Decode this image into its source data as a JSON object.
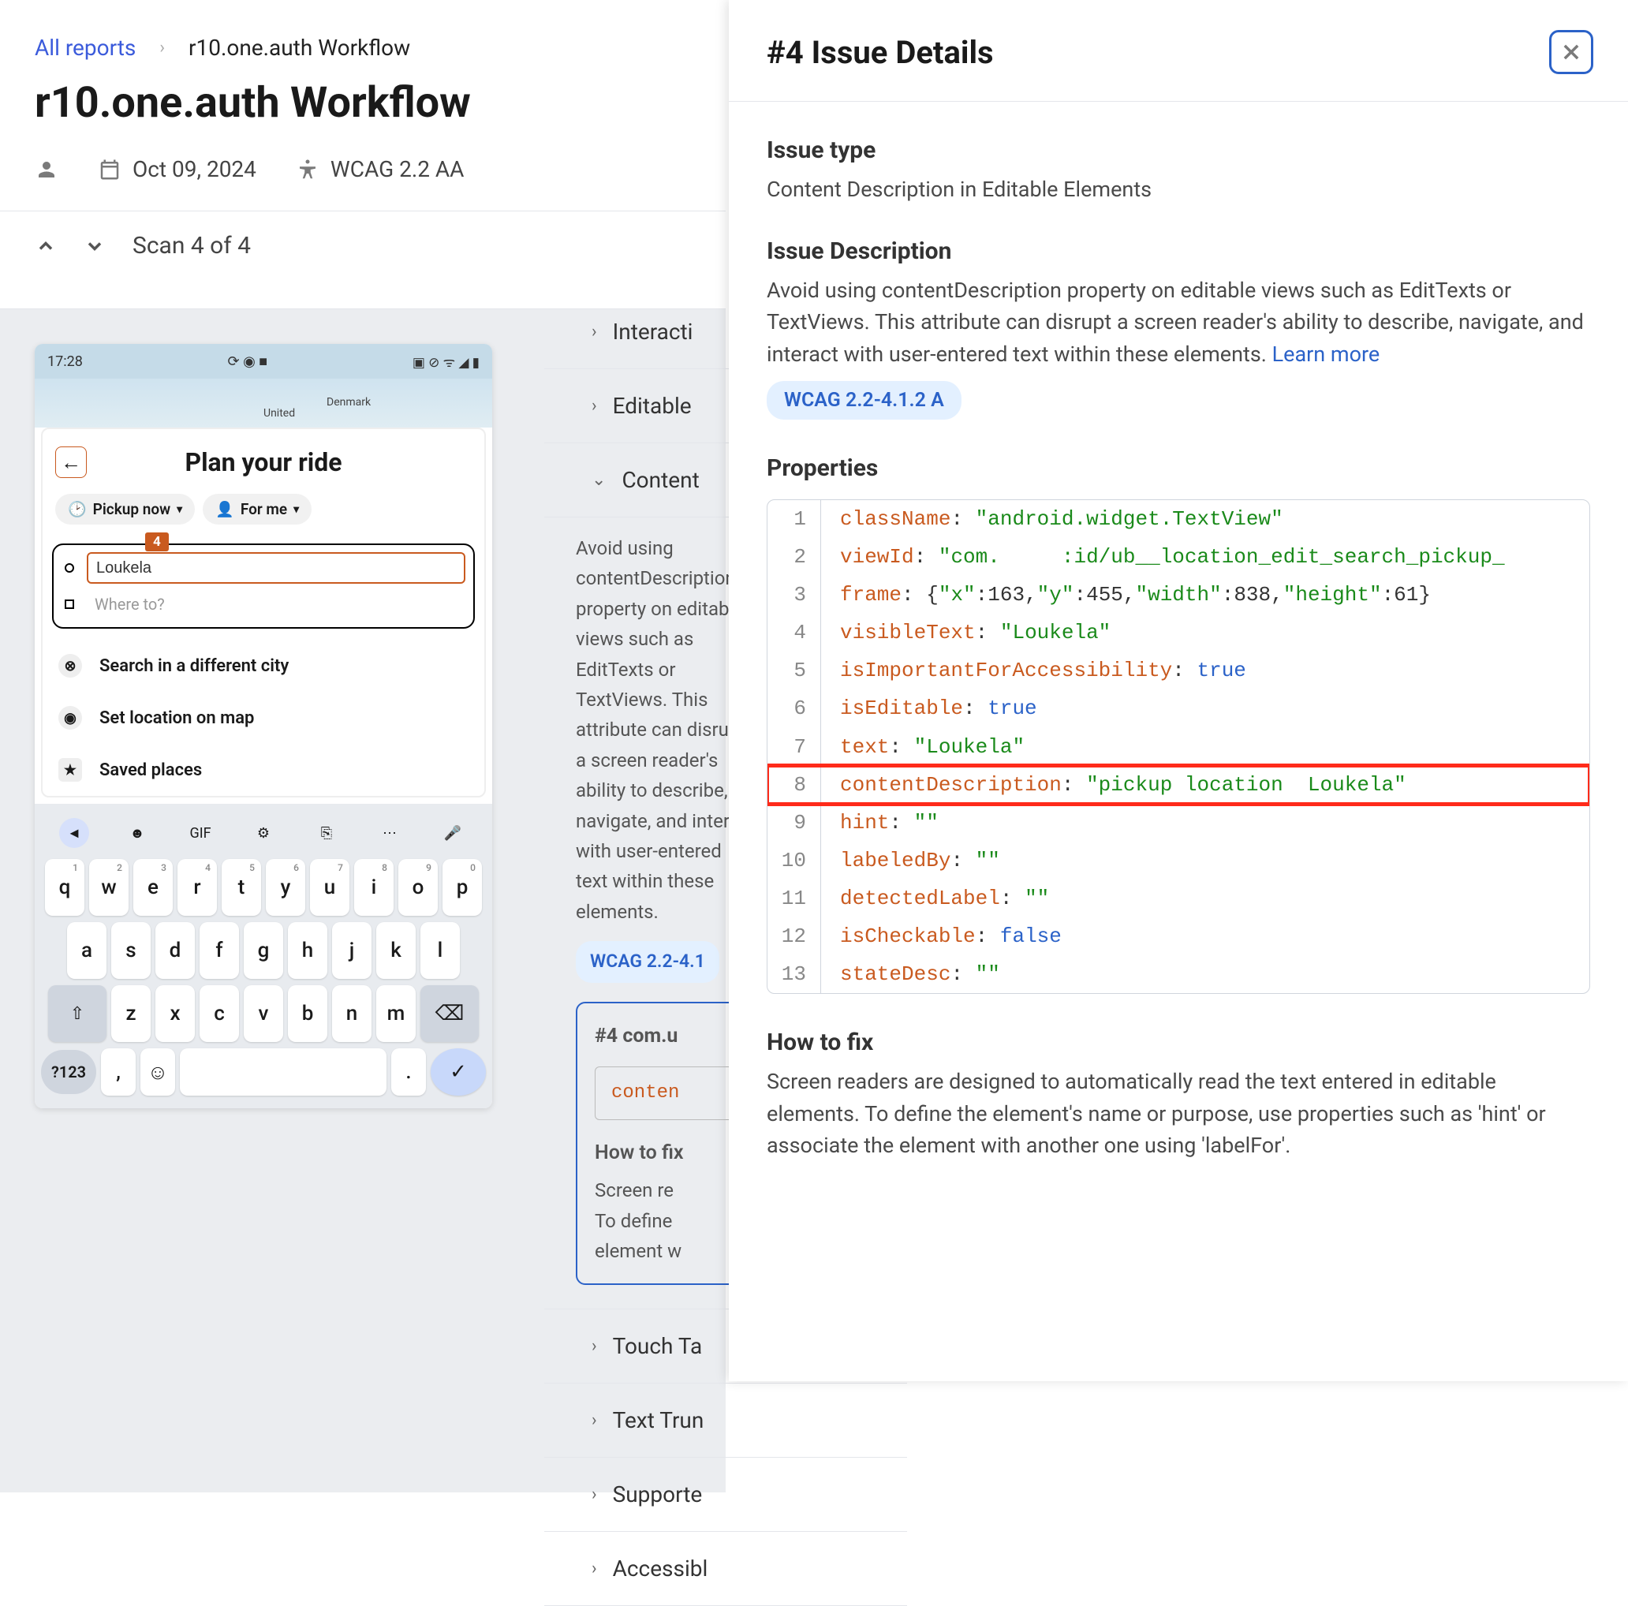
{
  "breadcrumb": {
    "root": "All reports",
    "current": "r10.one.auth Workflow"
  },
  "page_title": "r10.one.auth Workflow",
  "meta": {
    "date": "Oct 09, 2024",
    "standard": "WCAG 2.2 AA"
  },
  "scan_nav": "Scan 4 of 4",
  "phone": {
    "time": "17:28",
    "status_icons": "⟳ ◉ ■",
    "wifi_icons": "▣ ⊘ ᯤ ◢ ▮",
    "map_labels": [
      "United",
      "Denmark"
    ],
    "card_title": "Plan your ride",
    "chips": [
      {
        "icon": "🕑",
        "label": "Pickup now",
        "dd": "▾"
      },
      {
        "icon": "👤",
        "label": "For me",
        "dd": "▾"
      }
    ],
    "badge": "4",
    "pickup_value": "Loukela",
    "dest_placeholder": "Where to?",
    "options": [
      {
        "icon": "⊗",
        "label": "Search in a different city"
      },
      {
        "icon": "◉",
        "label": "Set location on map"
      },
      {
        "icon": "★",
        "label": "Saved places"
      }
    ],
    "kb_top_icons": [
      "◄",
      "☻",
      "GIF",
      "⚙",
      "⎘",
      "⋯",
      "🎤"
    ],
    "kb_r1": [
      [
        "q",
        "1"
      ],
      [
        "w",
        "2"
      ],
      [
        "e",
        "3"
      ],
      [
        "r",
        "4"
      ],
      [
        "t",
        "5"
      ],
      [
        "y",
        "6"
      ],
      [
        "u",
        "7"
      ],
      [
        "i",
        "8"
      ],
      [
        "o",
        "9"
      ],
      [
        "p",
        "0"
      ]
    ],
    "kb_r2": [
      "a",
      "s",
      "d",
      "f",
      "g",
      "h",
      "j",
      "k",
      "l"
    ],
    "kb_r3": [
      "z",
      "x",
      "c",
      "v",
      "b",
      "n",
      "m"
    ],
    "kb_123": "?123"
  },
  "categories": {
    "items": [
      "Interacti",
      "Editable",
      "Content",
      "Touch Ta",
      "Text Trun",
      "Supporte",
      "Accessibl"
    ],
    "expanded_desc": "Avoid using contentDescription property on editable views such as EditTexts or TextViews. This attribute can disrupt a screen reader's ability to describe, navigate, and interact with user-entered text within these elements.",
    "expanded_pill": "WCAG 2.2-4.1",
    "issue_id": "#4 com.u",
    "snippet_key": "conten",
    "howto_h": "How to fix",
    "howto_l1": "Screen re",
    "howto_l2": "To define",
    "howto_l3": "element w"
  },
  "panel": {
    "title": "#4 Issue Details",
    "issue_type_h": "Issue type",
    "issue_type": "Content Description in Editable Elements",
    "issue_desc_h": "Issue Description",
    "issue_desc": "Avoid using contentDescription property on editable views such as EditTexts or TextViews. This attribute can disrupt a screen reader's ability to describe, navigate, and interact with user-entered text within these elements. ",
    "learn_more": "Learn more",
    "wcag_pill": "WCAG 2.2-4.1.2 A",
    "properties_h": "Properties",
    "code": [
      {
        "n": 1,
        "k": "className",
        "v": "\"android.widget.TextView\"",
        "t": "s"
      },
      {
        "n": 2,
        "k": "viewId",
        "v": "\"com.     :id/ub__location_edit_search_pickup_",
        "t": "s"
      },
      {
        "n": 3,
        "k": "frame",
        "v": "{\"x\":163,\"y\":455,\"width\":838,\"height\":61}",
        "t": "obj"
      },
      {
        "n": 4,
        "k": "visibleText",
        "v": "\"Loukela\"",
        "t": "s"
      },
      {
        "n": 5,
        "k": "isImportantForAccessibility",
        "v": "true",
        "t": "b"
      },
      {
        "n": 6,
        "k": "isEditable",
        "v": "true",
        "t": "b"
      },
      {
        "n": 7,
        "k": "text",
        "v": "\"Loukela\"",
        "t": "s"
      },
      {
        "n": 8,
        "k": "contentDescription",
        "v": "\"pickup location  Loukela\"",
        "t": "s",
        "hl": true
      },
      {
        "n": 9,
        "k": "hint",
        "v": "\"\"",
        "t": "s"
      },
      {
        "n": 10,
        "k": "labeledBy",
        "v": "\"\"",
        "t": "s"
      },
      {
        "n": 11,
        "k": "detectedLabel",
        "v": "\"\"",
        "t": "s"
      },
      {
        "n": 12,
        "k": "isCheckable",
        "v": "false",
        "t": "b"
      },
      {
        "n": 13,
        "k": "stateDesc",
        "v": "\"\"",
        "t": "s"
      }
    ],
    "howto_h": "How to fix",
    "howto": "Screen readers are designed to automatically read the text entered in editable elements. To define the element's name or purpose, use properties such as 'hint' or associate the element with another one using 'labelFor'."
  }
}
